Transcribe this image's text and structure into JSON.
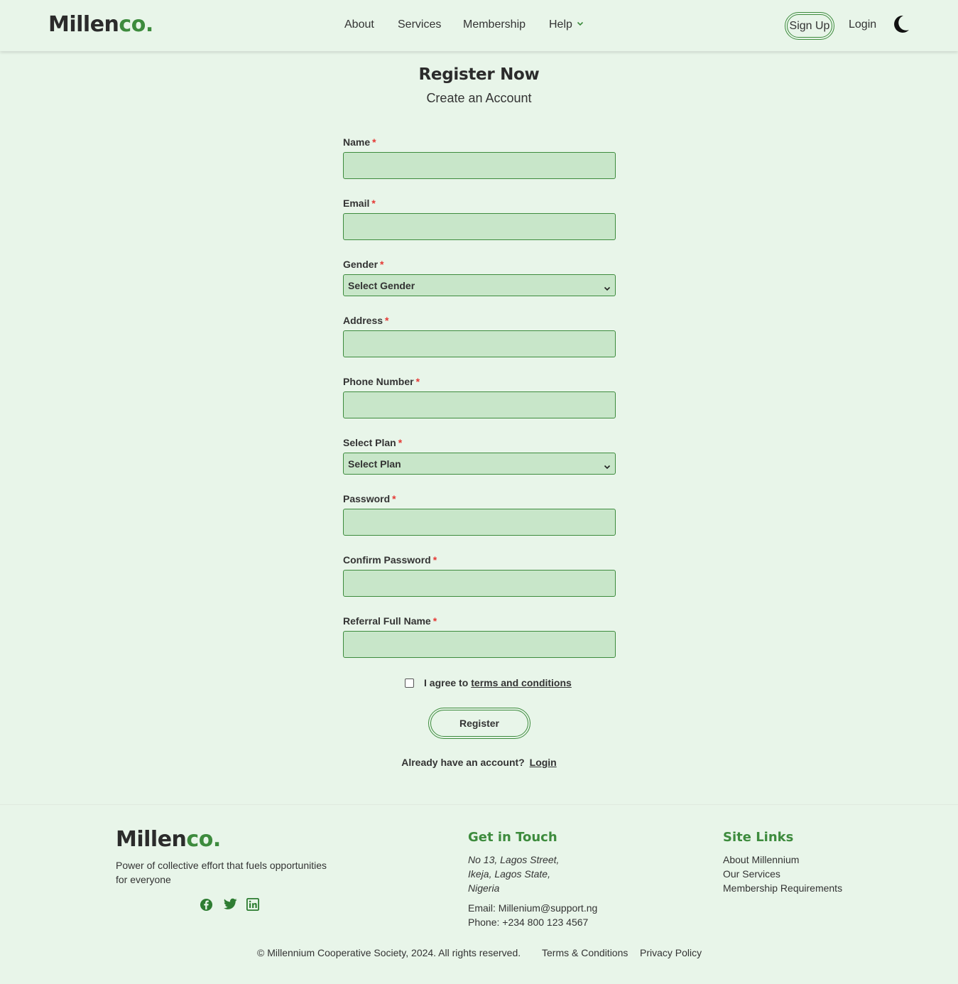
{
  "brand": {
    "name_dark": "Millen",
    "name_green": "co."
  },
  "nav": {
    "about": "About",
    "services": "Services",
    "membership": "Membership",
    "help": "Help",
    "signup": "Sign Up",
    "login": "Login"
  },
  "page": {
    "title": "Register Now",
    "subtitle": "Create an Account"
  },
  "form": {
    "fields": [
      {
        "label": "Name",
        "required": "*"
      },
      {
        "label": "Email",
        "required": "*"
      },
      {
        "label": "Gender",
        "required": "*",
        "selected": "Select Gender"
      },
      {
        "label": "Address",
        "required": "*"
      },
      {
        "label": "Phone Number",
        "required": "*"
      },
      {
        "label": "Select Plan",
        "required": "*",
        "selected": "Select Plan"
      },
      {
        "label": "Password",
        "required": "*"
      },
      {
        "label": "Confirm Password",
        "required": "*"
      },
      {
        "label": "Referral Full Name",
        "required": "*"
      }
    ],
    "agree_text": "I agree to",
    "terms_text": "terms and conditions",
    "register_label": "Register",
    "already_text": "Already have an account?",
    "login_text": "Login"
  },
  "footer": {
    "tagline_line1": "Power of collective effort that fuels opportunities",
    "tagline_line2": "for everyone",
    "get_in_touch": "Get in Touch",
    "address": [
      "No 13, Lagos Street,",
      "Ikeja, Lagos State,",
      "Nigeria"
    ],
    "email": "Email: Millenium@support.ng",
    "phone": "Phone: +234 800 123 4567",
    "site_links_heading": "Site Links",
    "site_links": [
      "About Millennium",
      "Our Services",
      "Membership Requirements"
    ],
    "copyright": "© Millennium Cooperative Society, 2024. All rights reserved.",
    "terms": "Terms & Conditions",
    "privacy": "Privacy Policy"
  },
  "colors": {
    "accent": "#3d8b3d",
    "background": "#e8f5e9",
    "input_bg": "#c8e6c9",
    "required": "#e53935"
  }
}
